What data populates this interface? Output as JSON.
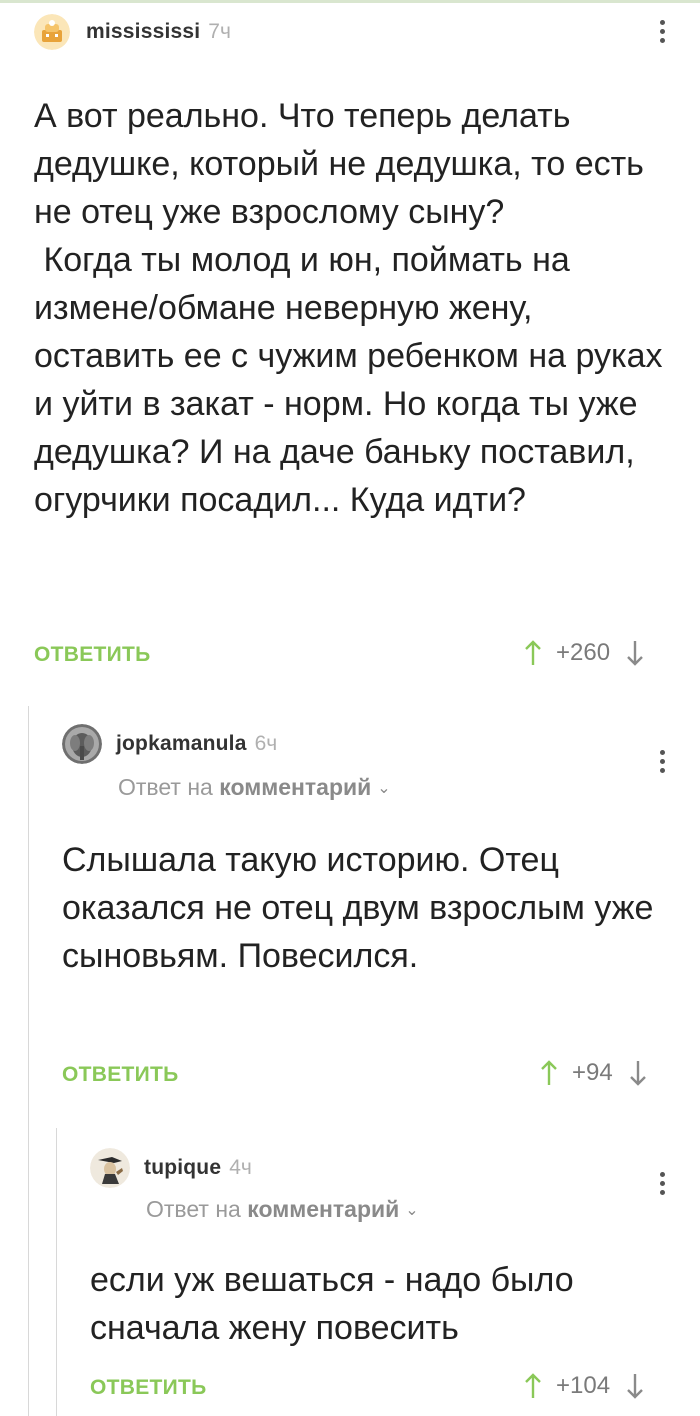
{
  "comments": [
    {
      "username": "missississi",
      "time": "7ч",
      "text": "А вот реально. Что теперь делать дедушке, который не дедушка, то есть не отец уже взрослому сыну?\n Когда ты молод и юн, поймать на измене/обмане неверную жену, оставить ее с чужим ребенком на руках и уйти в закат - норм. Но когда ты уже дедушка? И на даче баньку поставил, огурчики посадил... Куда идти?",
      "reply_label": "ОТВЕТИТЬ",
      "score": "+260"
    },
    {
      "username": "jopkamanula",
      "time": "6ч",
      "reply_prefix": "Ответ на",
      "reply_target": "комментарий",
      "text": "Слышала такую историю. Отец оказался не отец двум взрослым уже сыновьям. Повесился.",
      "reply_label": "ОТВЕТИТЬ",
      "score": "+94"
    },
    {
      "username": "tupique",
      "time": "4ч",
      "reply_prefix": "Ответ на",
      "reply_target": "комментарий",
      "text": "если уж вешаться - надо было сначала жену повесить",
      "reply_label": "ОТВЕТИТЬ",
      "score": "+104"
    }
  ],
  "colors": {
    "accent_green": "#8ac858",
    "text": "#222222",
    "muted": "#9a9a9a",
    "thread_line": "#d8d8d8"
  },
  "icons": {
    "menu": "more-vertical-icon",
    "upvote": "arrow-up-icon",
    "downvote": "arrow-down-icon"
  }
}
